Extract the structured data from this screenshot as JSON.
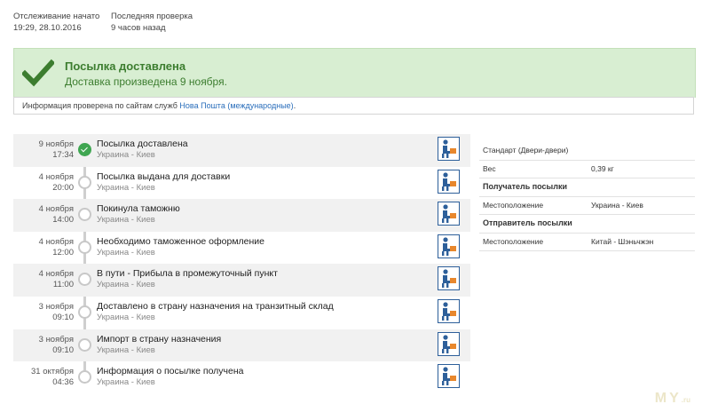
{
  "header": {
    "started": {
      "label": "Отслеживание начато",
      "value": "19:29, 28.10.2016"
    },
    "lastcheck": {
      "label": "Последняя проверка",
      "value": "9 часов назад"
    }
  },
  "banner": {
    "title": "Посылка доставлена",
    "subtitle": "Доставка произведена 9 ноября.",
    "color": "#3c7d2f",
    "background": "#d8eed2"
  },
  "infobar": {
    "prefix": "Информация проверена по сайтам служб ",
    "link": "Нова Пошта (международные)",
    "suffix": "."
  },
  "events": [
    {
      "date": "9 ноября",
      "time": "17:34",
      "status": "Посылка доставлена",
      "location": "Украина - Киев",
      "done": true
    },
    {
      "date": "4 ноября",
      "time": "20:00",
      "status": "Посылка выдана для доставки",
      "location": "Украина - Киев",
      "done": false
    },
    {
      "date": "4 ноября",
      "time": "14:00",
      "status": "Покинула таможню",
      "location": "Украина - Киев",
      "done": false
    },
    {
      "date": "4 ноября",
      "time": "12:00",
      "status": "Необходимо таможенное оформление",
      "location": "Украина - Киев",
      "done": false
    },
    {
      "date": "4 ноября",
      "time": "11:00",
      "status": "В пути - Прибыла в промежуточный пункт",
      "location": "Украина - Киев",
      "done": false
    },
    {
      "date": "3 ноября",
      "time": "09:10",
      "status": "Доставлено в страну назначения на транзитный склад",
      "location": "Украина - Киев",
      "done": false
    },
    {
      "date": "3 ноября",
      "time": "09:10",
      "status": "Импорт в страну назначения",
      "location": "Украина - Киев",
      "done": false
    },
    {
      "date": "31 октября",
      "time": "04:36",
      "status": "Информация о посылке получена",
      "location": "Украина - Киев",
      "done": false
    }
  ],
  "details": [
    {
      "key": "Стандарт (Двери-двери)",
      "value": "",
      "head": false
    },
    {
      "key": "Вес",
      "value": "0,39 кг",
      "head": false
    },
    {
      "key": "Получатель посылки",
      "value": "",
      "head": true
    },
    {
      "key": "Местоположение",
      "value": "Украина - Киев",
      "head": false
    },
    {
      "key": "Отправитель посылки",
      "value": "",
      "head": true
    },
    {
      "key": "Местоположение",
      "value": "Китай - Шэньчжэн",
      "head": false
    }
  ],
  "watermark": {
    "main": "MY",
    "suffix": ".ru"
  },
  "icons": {
    "delivered": "checkmark-icon",
    "service": "courier-service-icon",
    "status_dot": "timeline-dot-icon"
  }
}
